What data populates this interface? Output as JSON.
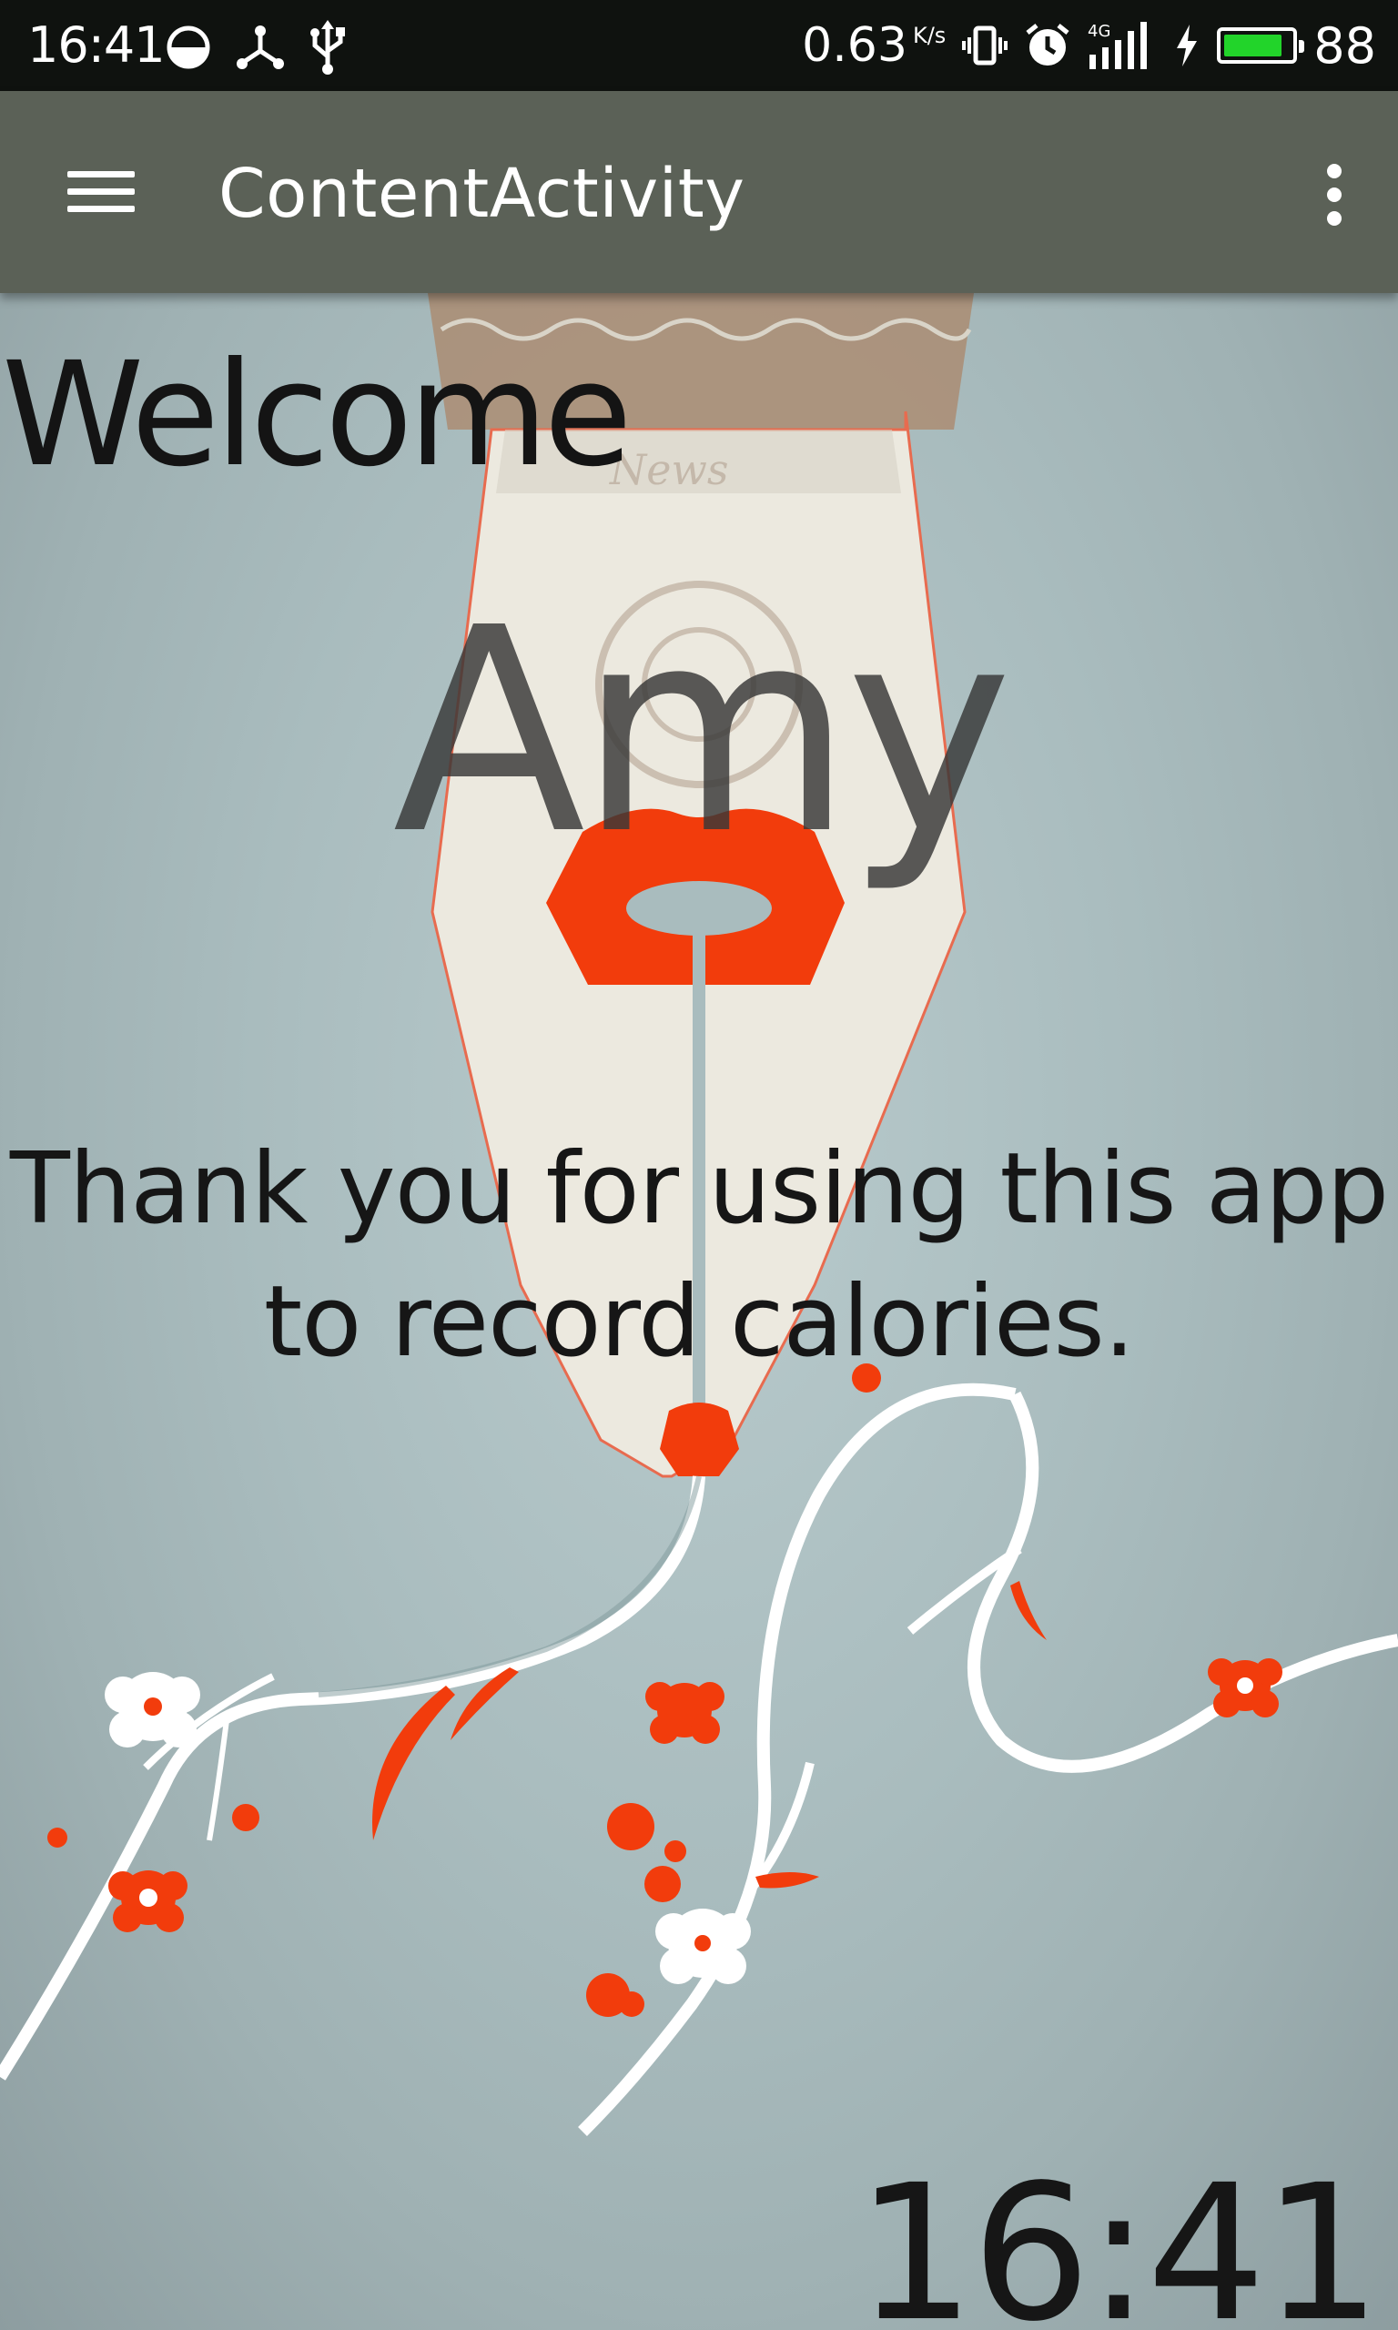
{
  "status_bar": {
    "time": "16:41",
    "speed_value": "0.63",
    "speed_unit": "K/s",
    "network_label": "4G",
    "battery_level": "88",
    "battery_fraction": 0.88,
    "battery_color": "#22d42a",
    "icons": [
      "half-circle-icon",
      "usb-share-icon",
      "usb-icon",
      "vibrate-icon",
      "alarm-icon",
      "signal-icon",
      "charging-icon",
      "battery-icon"
    ]
  },
  "toolbar": {
    "title": "ContentActivity",
    "background": "#5b6157",
    "menu_icon": "hamburger-menu-icon",
    "overflow_icon": "more-vert-icon"
  },
  "content": {
    "welcome": "Welcome",
    "name": "Amy",
    "message": "Thank you for using this app to record calories.",
    "clock": "16:41",
    "accent": "#f23c0c"
  }
}
